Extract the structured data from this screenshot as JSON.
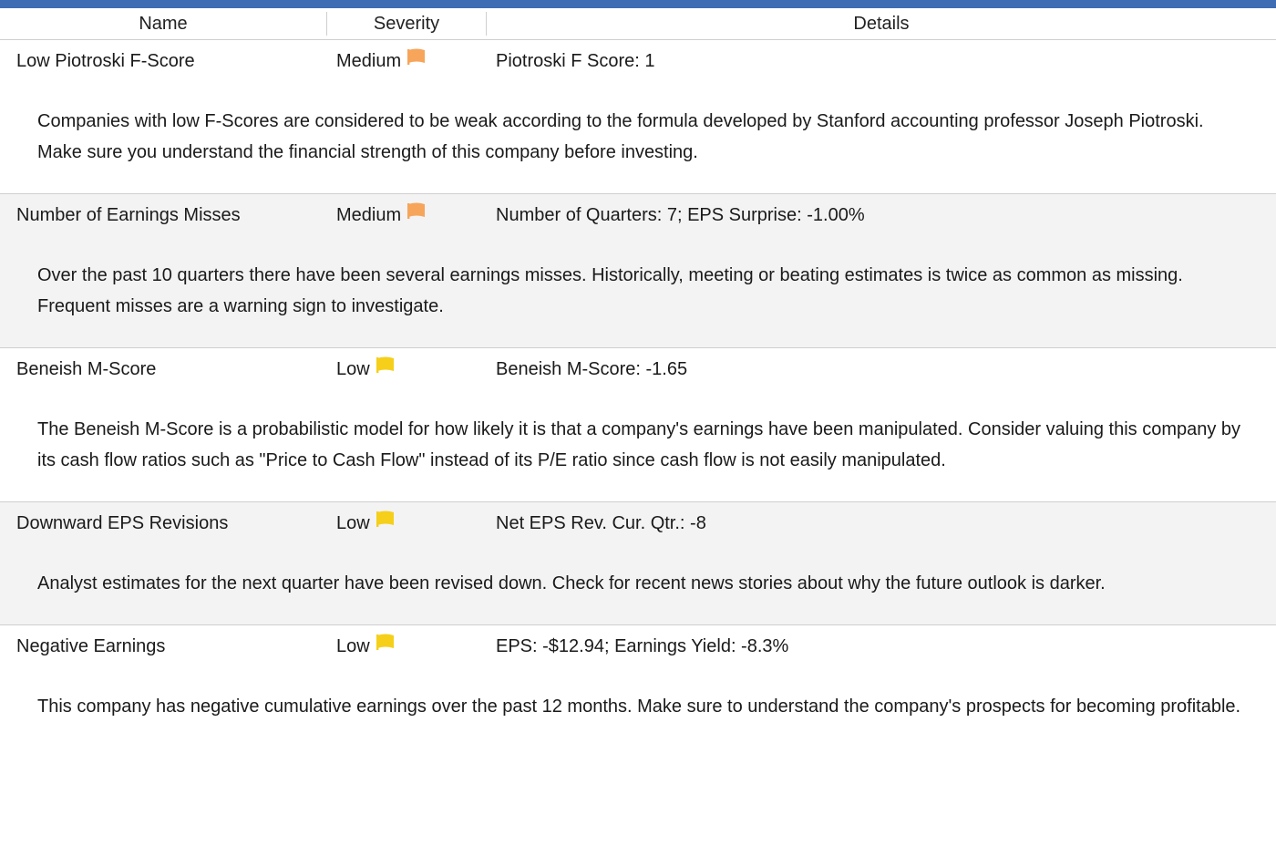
{
  "header": {
    "name": "Name",
    "severity": "Severity",
    "details": "Details"
  },
  "colors": {
    "top_bar": "#3f6db3",
    "medium_flag": "#f6a55a",
    "low_flag": "#f5cf1a",
    "alt_row": "#f3f3f3"
  },
  "rows": [
    {
      "name": "Low Piotroski F-Score",
      "severity": "Medium",
      "flag_icon": "orange-flag-icon",
      "details": "Piotroski F Score: 1",
      "description": "Companies with low F-Scores are considered to be weak according to the formula developed by Stanford accounting professor Joseph Piotroski. Make sure you understand the financial strength of this company before investing."
    },
    {
      "name": "Number of Earnings Misses",
      "severity": "Medium",
      "flag_icon": "orange-flag-icon",
      "details": "Number of Quarters: 7;  EPS Surprise: -1.00%",
      "description": "Over the past 10 quarters there have been several earnings misses. Historically, meeting or beating estimates is twice as common as missing. Frequent misses are a warning sign to investigate."
    },
    {
      "name": "Beneish M-Score",
      "severity": "Low",
      "flag_icon": "yellow-flag-icon",
      "details": "Beneish M-Score: -1.65",
      "description": "The Beneish M-Score is a probabilistic model for how likely it is that a company's earnings have been manipulated. Consider valuing this company by its cash flow ratios such as \"Price to Cash Flow\" instead of its P/E ratio since cash flow is not easily manipulated."
    },
    {
      "name": "Downward EPS Revisions",
      "severity": "Low",
      "flag_icon": "yellow-flag-icon",
      "details": "Net EPS Rev. Cur. Qtr.: -8",
      "description": "Analyst estimates for the next quarter have been revised down. Check for recent news stories about why the future outlook is darker."
    },
    {
      "name": "Negative Earnings",
      "severity": "Low",
      "flag_icon": "yellow-flag-icon",
      "details": "EPS: -$12.94;  Earnings Yield: -8.3%",
      "description": "This company has negative cumulative earnings over the past 12 months. Make sure to understand the company's prospects for becoming profitable."
    }
  ]
}
